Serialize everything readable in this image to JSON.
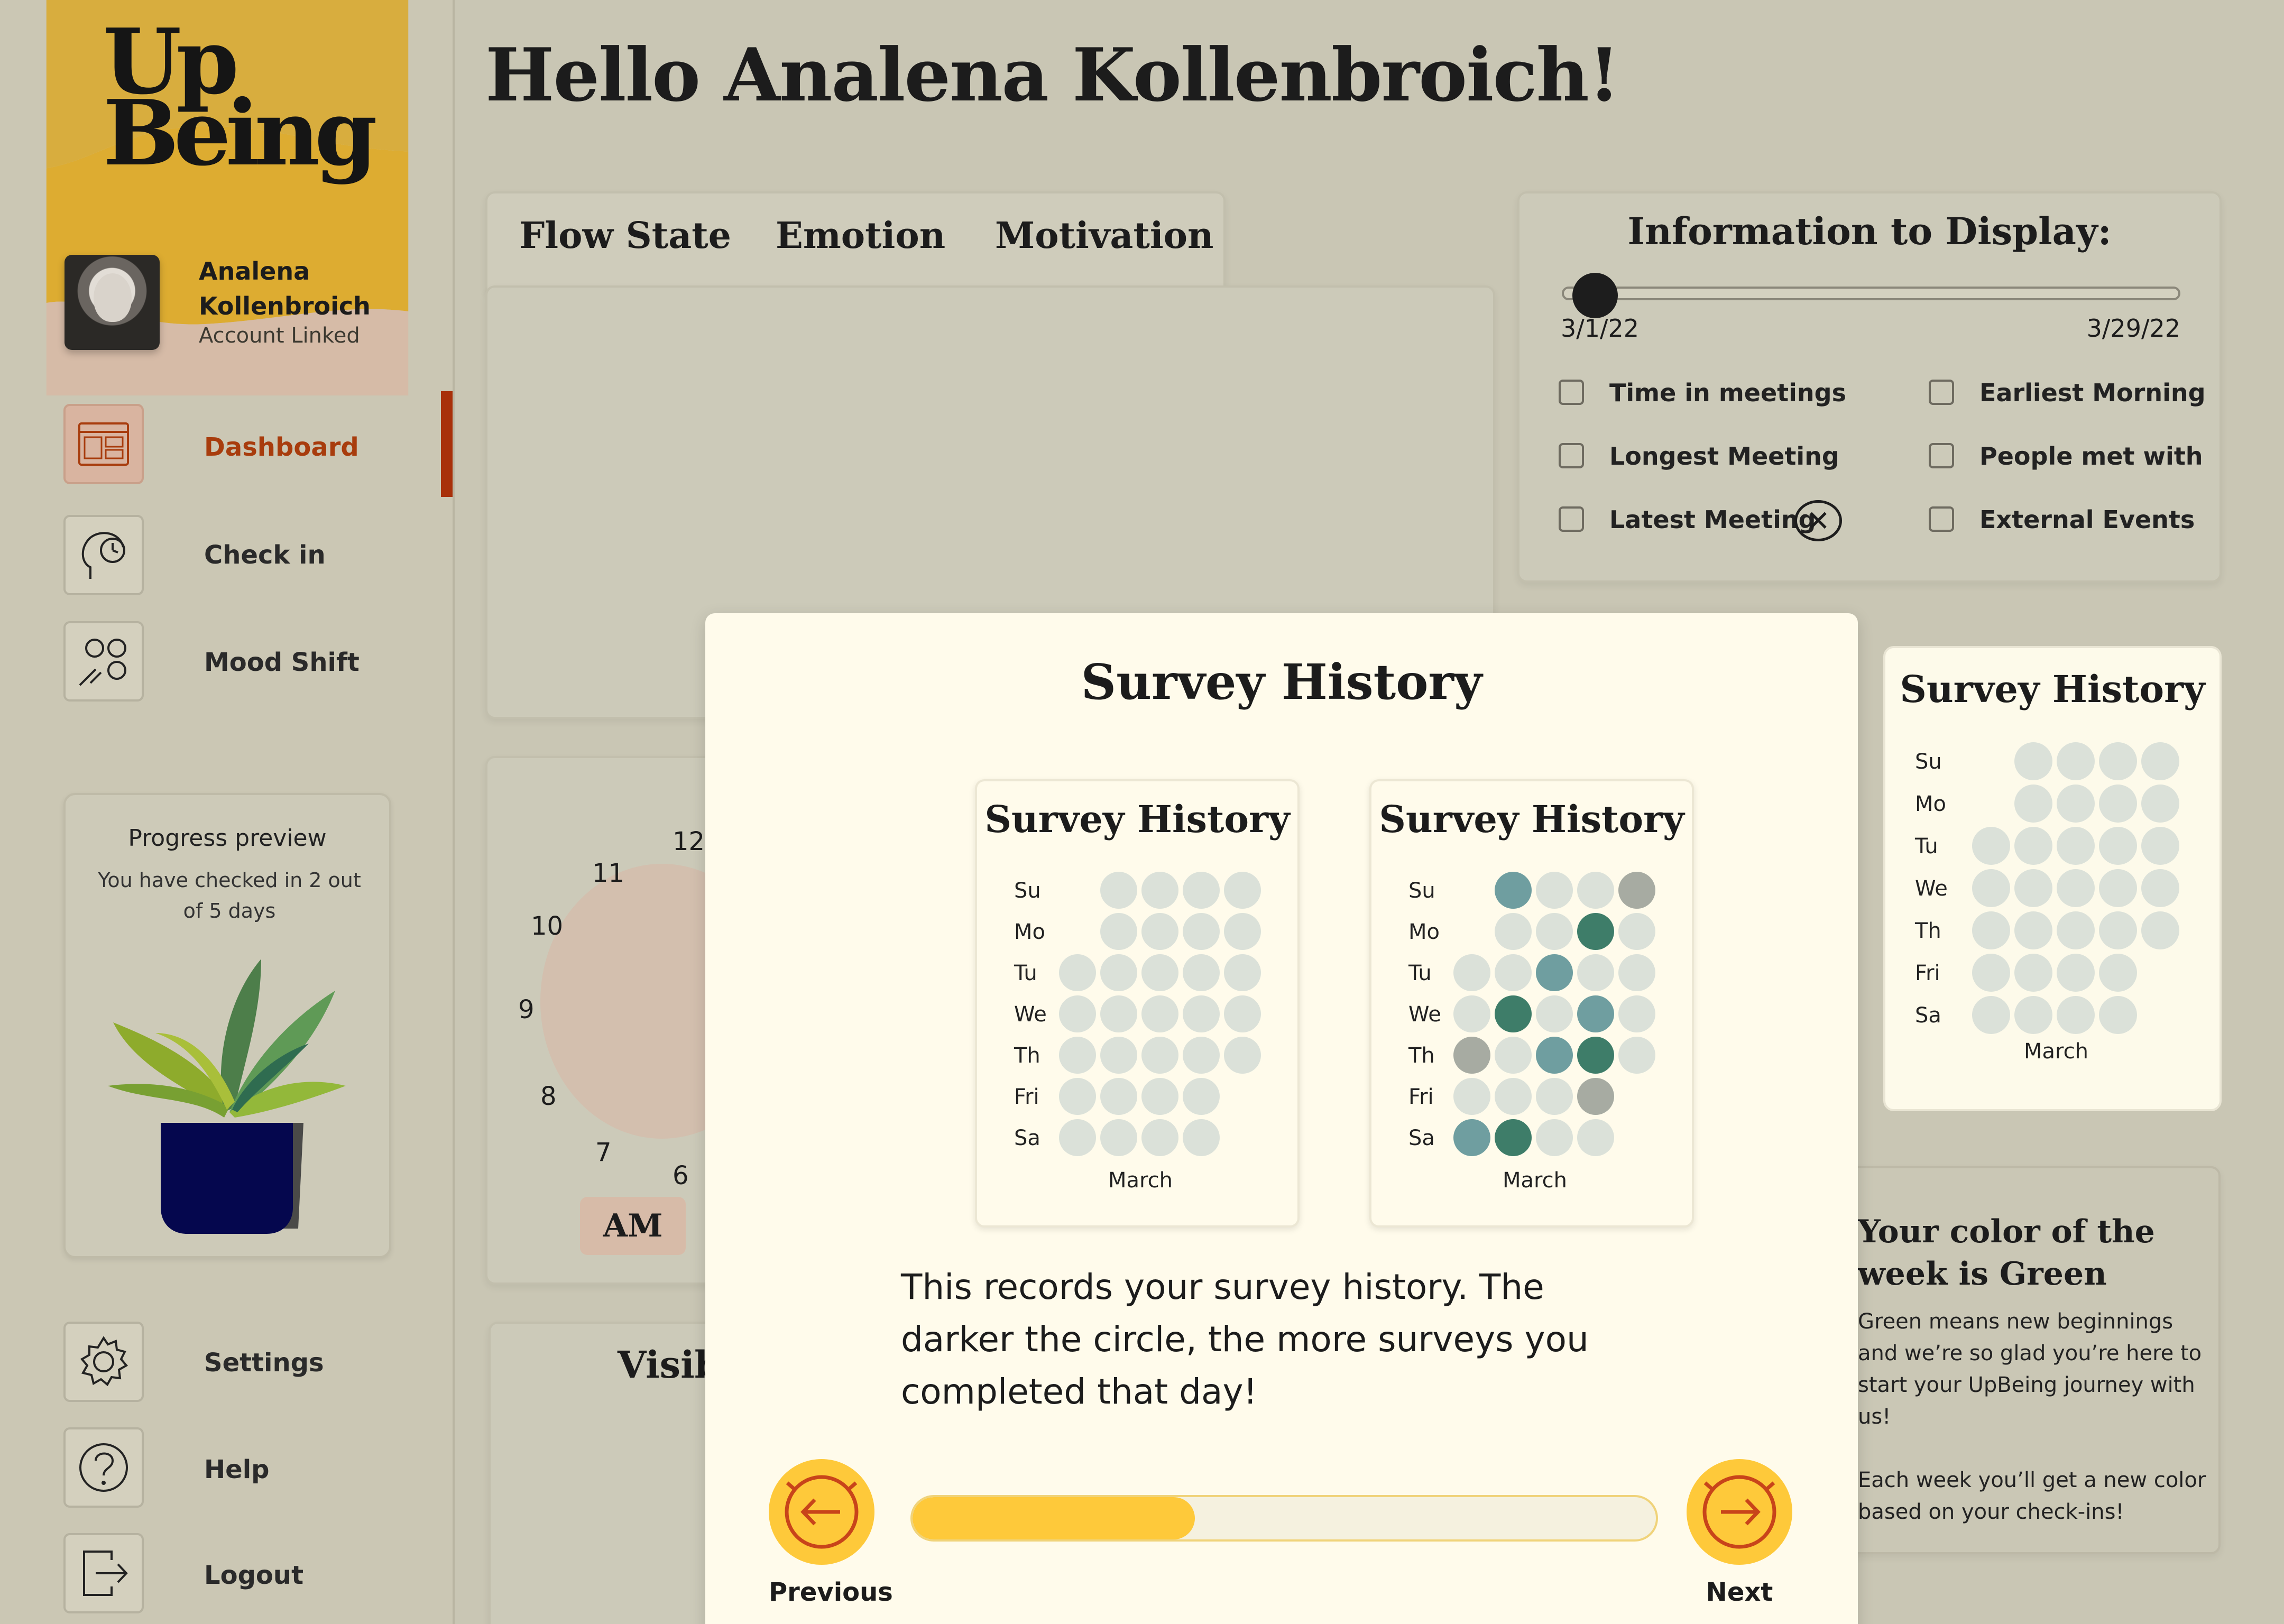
{
  "app": {
    "logo_line1": "Up",
    "logo_line2": "Being"
  },
  "profile": {
    "name": "Analena Kollenbroich",
    "status": "Account Linked"
  },
  "nav": {
    "dashboard": "Dashboard",
    "checkin": "Check in",
    "mood_shift": "Mood Shift",
    "settings": "Settings",
    "help": "Help",
    "logout": "Logout"
  },
  "progress_preview": {
    "title": "Progress preview",
    "text": "You have checked in 2 out of 5 days"
  },
  "greeting": "Hello Analena Kollenbroich!",
  "tabs": [
    "Flow State",
    "Emotion",
    "Motivation"
  ],
  "info_display": {
    "title": "Information to Display:",
    "range_start": "3/1/22",
    "range_end": "3/29/22",
    "options": [
      {
        "label": "Time in meetings",
        "checked": false
      },
      {
        "label": "Earliest Morning",
        "checked": false
      },
      {
        "label": "Longest Meeting",
        "checked": false
      },
      {
        "label": "People met with",
        "checked": false
      },
      {
        "label": "Latest Meeting",
        "checked": false
      },
      {
        "label": "External Events",
        "checked": false
      }
    ]
  },
  "clock": {
    "numbers": [
      "12",
      "11",
      "10",
      "9",
      "8",
      "7",
      "6"
    ],
    "am_label": "AM"
  },
  "visibility_panel": {
    "label": "Visib"
  },
  "color_of_week": {
    "title": "Your color of the week is Green",
    "body1": "Green means new beginnings and we’re so glad you’re here to start your UpBeing journey with us!",
    "body2": "Each week you’ll get a new color based on your check-ins!"
  },
  "survey_history": {
    "title": "Survey History",
    "days": [
      "Su",
      "Mo",
      "Tu",
      "We",
      "Th",
      "Fri",
      "Sa"
    ],
    "month": "March",
    "calendar_grid_a": [
      [
        null,
        0,
        0,
        0,
        0
      ],
      [
        null,
        0,
        0,
        0,
        0
      ],
      [
        0,
        0,
        0,
        0,
        0
      ],
      [
        0,
        0,
        0,
        0,
        0
      ],
      [
        0,
        0,
        0,
        0,
        0
      ],
      [
        0,
        0,
        0,
        0,
        null
      ],
      [
        0,
        0,
        0,
        0,
        null
      ]
    ],
    "calendar_grid_b": [
      [
        null,
        2,
        0,
        0,
        1
      ],
      [
        null,
        0,
        0,
        3,
        0
      ],
      [
        0,
        0,
        2,
        0,
        0
      ],
      [
        0,
        3,
        0,
        2,
        0
      ],
      [
        1,
        0,
        2,
        3,
        0
      ],
      [
        0,
        0,
        0,
        1,
        null
      ],
      [
        2,
        3,
        0,
        0,
        null
      ]
    ],
    "calendar_grid_right": [
      [
        null,
        0,
        0,
        0,
        0
      ],
      [
        null,
        0,
        0,
        0,
        0
      ],
      [
        0,
        0,
        0,
        0,
        0
      ],
      [
        0,
        0,
        0,
        0,
        0
      ],
      [
        0,
        0,
        0,
        0,
        0
      ],
      [
        0,
        0,
        0,
        0,
        null
      ],
      [
        0,
        0,
        0,
        0,
        null
      ]
    ],
    "level_colors": [
      "#dbe1d9",
      "#a7aba2",
      "#6f9ea0",
      "#3e7d69"
    ]
  },
  "modal": {
    "title": "Survey History",
    "description": "This records your survey history. The darker the circle, the more surveys you completed that day!",
    "prev_label": "Previous",
    "next_label": "Next",
    "progress_fraction": 0.38
  },
  "colors": {
    "sidebar_top": "#d8ad3e",
    "accent_red": "#a83c0d",
    "button_yellow": "#fec93a",
    "modal_bg": "#fffbeb"
  }
}
